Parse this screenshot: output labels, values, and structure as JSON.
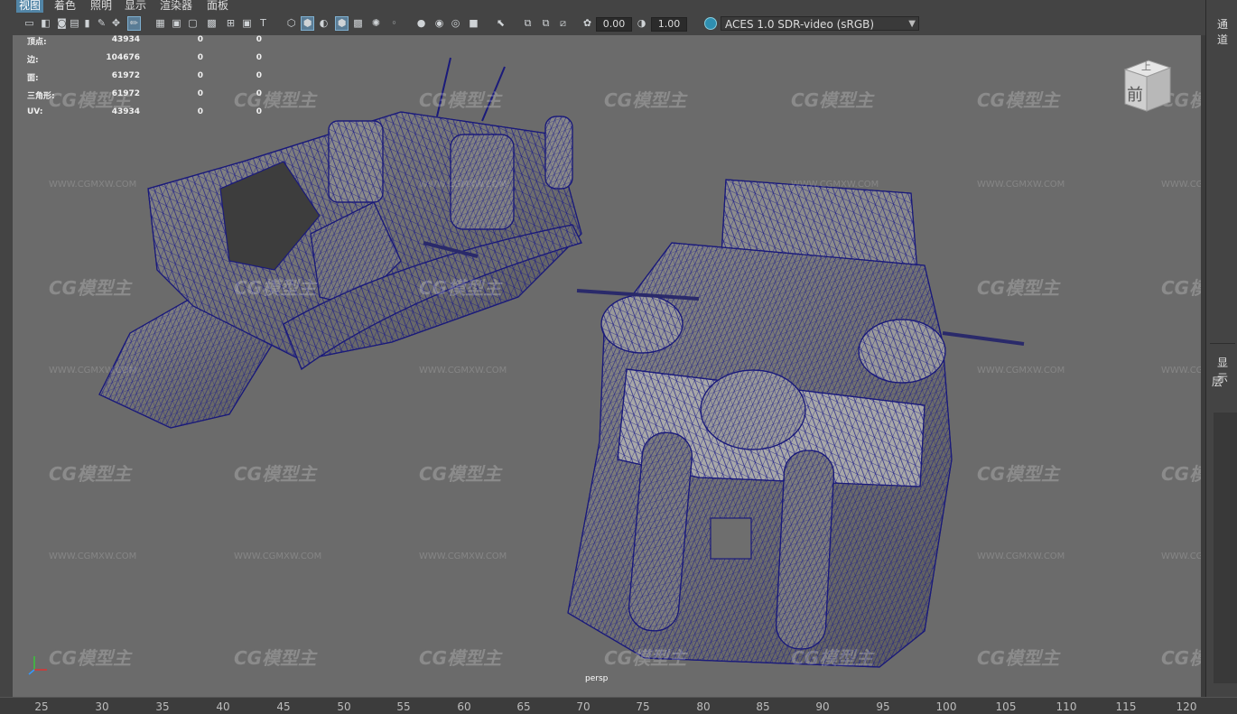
{
  "menu": [
    "视图",
    "着色",
    "照明",
    "显示",
    "渲染器",
    "面板"
  ],
  "menu_active_index": 0,
  "toolbar": {
    "exposure": "0.00",
    "gamma": "1.00",
    "color_space": "ACES 1.0 SDR-video (sRGB)"
  },
  "hud": {
    "rows": [
      {
        "label": "顶点:",
        "v1": "43934",
        "v2": "0",
        "v3": "0"
      },
      {
        "label": "边:",
        "v1": "104676",
        "v2": "0",
        "v3": "0"
      },
      {
        "label": "面:",
        "v1": "61972",
        "v2": "0",
        "v3": "0"
      },
      {
        "label": "三角形:",
        "v1": "61972",
        "v2": "0",
        "v3": "0"
      },
      {
        "label": "UV:",
        "v1": "43934",
        "v2": "0",
        "v3": "0"
      }
    ]
  },
  "viewcube": {
    "top_label": "上",
    "front_label": "前"
  },
  "camera_label": "persp",
  "watermark": {
    "logo": "CG模型主",
    "url": "WWW.CGMXW.COM"
  },
  "timeline": {
    "ticks": [
      "25",
      "30",
      "35",
      "40",
      "45",
      "50",
      "55",
      "60",
      "65",
      "70",
      "75",
      "80",
      "85",
      "90",
      "95",
      "100",
      "105",
      "110",
      "115",
      "120"
    ]
  },
  "right_panel": {
    "channel_label": "通道",
    "display_label": "显示",
    "layer_label": "层"
  },
  "colors": {
    "accent": "#5285a6",
    "wire": "#1a1a7a",
    "viewport_bg": "#6b6b6b"
  }
}
